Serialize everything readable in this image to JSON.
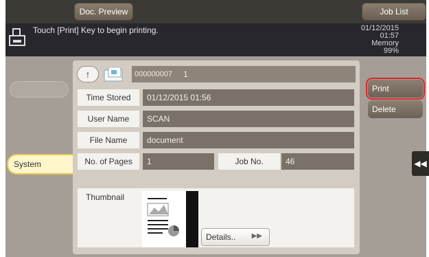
{
  "top": {
    "preview_label": "Doc. Preview",
    "joblist_label": "Job List"
  },
  "message": {
    "text": "Touch [Print] Key to begin printing.",
    "date": "01/12/2015",
    "time": "01:57",
    "memory_label": "Memory",
    "memory_value": "99%"
  },
  "sidebar": {
    "system_label": "System"
  },
  "header": {
    "job_id": "000000007",
    "count": "1"
  },
  "fields": {
    "time_stored_label": "Time Stored",
    "time_stored_value": "01/12/2015 01:56",
    "user_name_label": "User Name",
    "user_name_value": "SCAN",
    "file_name_label": "File Name",
    "file_name_value": "document",
    "pages_label": "No. of Pages",
    "pages_value": "1",
    "job_no_label": "Job No.",
    "job_no_value": "46"
  },
  "thumbnail": {
    "label": "Thumbnail",
    "details_label": "Details.."
  },
  "actions": {
    "print_label": "Print",
    "delete_label": "Delete"
  },
  "icons": {
    "printer": "printer-icon",
    "up": "upload-arrow-icon",
    "doc": "document-folder-icon",
    "details_arrow": "double-chevron-right-icon",
    "collapse": "double-chevron-left-icon"
  },
  "colors": {
    "highlight": "#e0262a",
    "system_tab": "#e8c84a"
  }
}
